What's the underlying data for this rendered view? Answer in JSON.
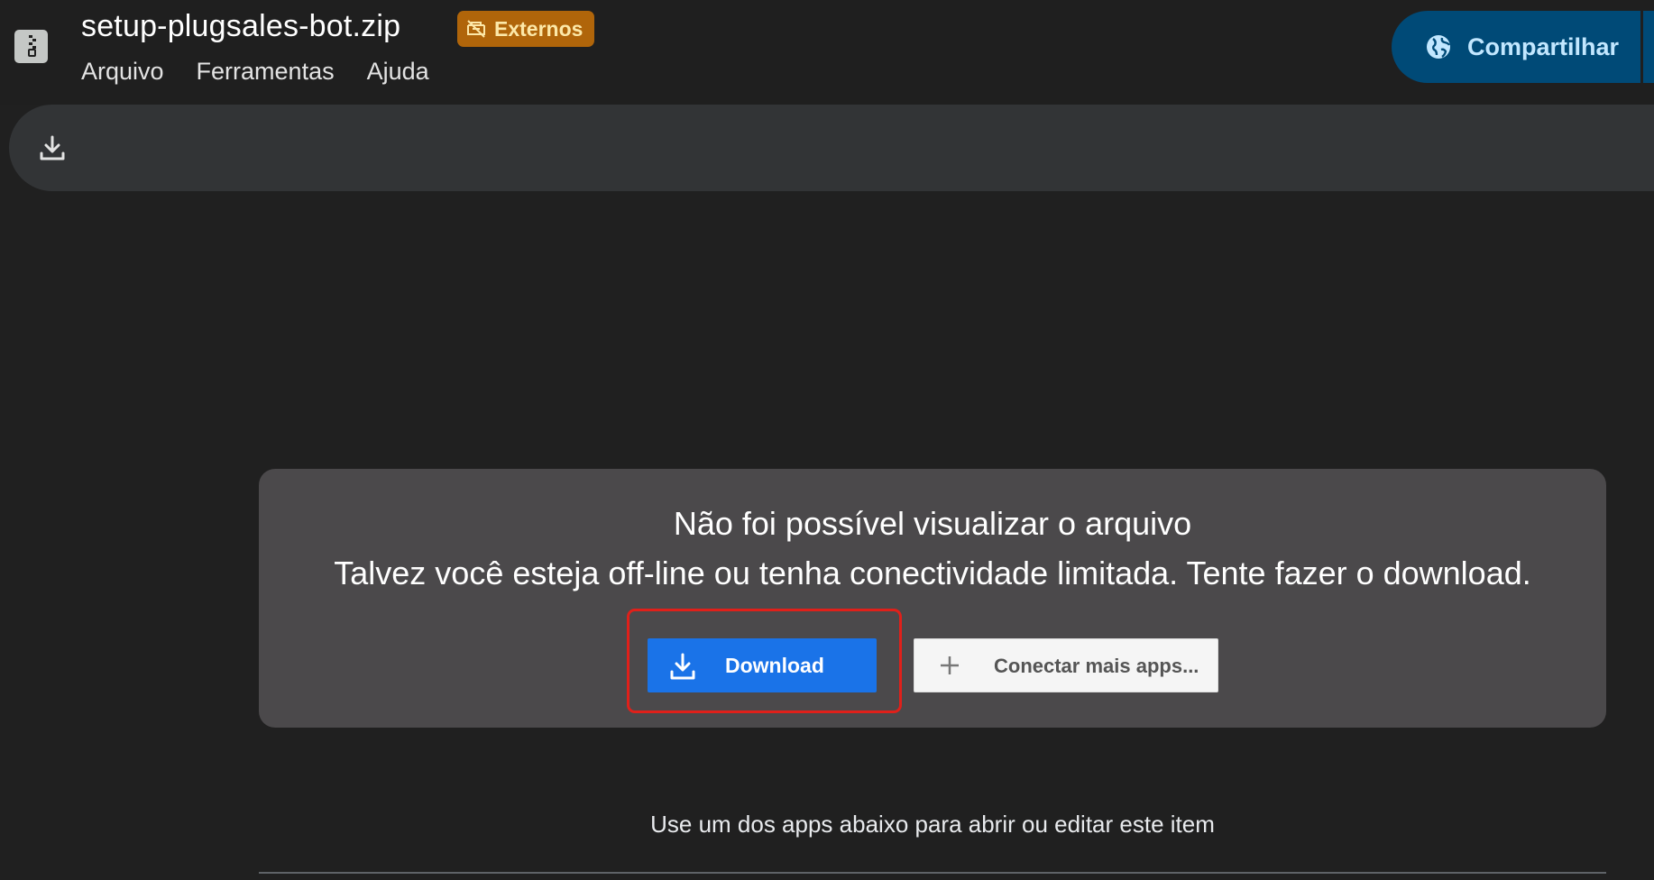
{
  "file": {
    "title": "setup-plugsales-bot.zip",
    "badge": "Externos",
    "icon": "zip-file-icon"
  },
  "menu": {
    "items": [
      "Arquivo",
      "Ferramentas",
      "Ajuda"
    ]
  },
  "share": {
    "label": "Compartilhar",
    "icon": "globe-icon"
  },
  "toolbar": {
    "download_icon": "download-icon"
  },
  "preview_error": {
    "title": "Não foi possível visualizar o arquivo",
    "message": "Talvez você esteja off-line ou tenha conectividade limitada. Tente fazer o download.",
    "download_label": "Download",
    "connect_label": "Conectar mais apps..."
  },
  "apps_hint": "Use um dos apps abaixo para abrir ou editar este item",
  "colors": {
    "background": "#202020",
    "badge": "#b0650a",
    "share_button": "#004a77",
    "download_button": "#1a73e8",
    "highlight": "#e0201a"
  }
}
